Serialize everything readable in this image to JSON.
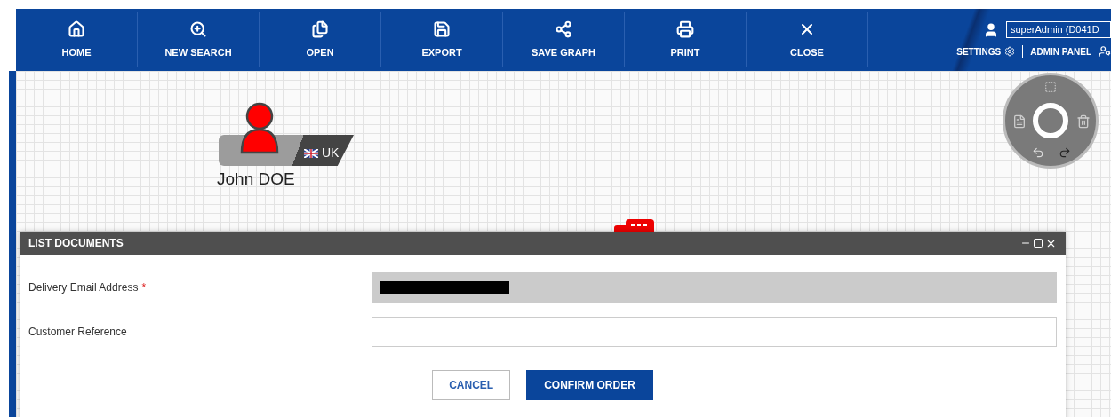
{
  "toolbar": {
    "items": [
      {
        "label": "HOME"
      },
      {
        "label": "NEW SEARCH"
      },
      {
        "label": "OPEN"
      },
      {
        "label": "EXPORT"
      },
      {
        "label": "SAVE GRAPH"
      },
      {
        "label": "PRINT"
      },
      {
        "label": "CLOSE"
      }
    ],
    "user": "superAdmin (D041D",
    "settings": "SETTINGS",
    "admin_panel": "ADMIN PANEL"
  },
  "canvas": {
    "node": {
      "name": "John DOE",
      "country": "UK"
    }
  },
  "dialog": {
    "title": "LIST DOCUMENTS",
    "fields": [
      {
        "label": "Delivery Email Address",
        "required_mark": "*",
        "redacted": true,
        "disabled": true
      },
      {
        "label": "Customer Reference",
        "redacted": false,
        "disabled": false
      }
    ],
    "buttons": [
      {
        "label": "CANCEL",
        "kind": "secondary"
      },
      {
        "label": "CONFIRM ORDER",
        "kind": "primary"
      }
    ]
  }
}
